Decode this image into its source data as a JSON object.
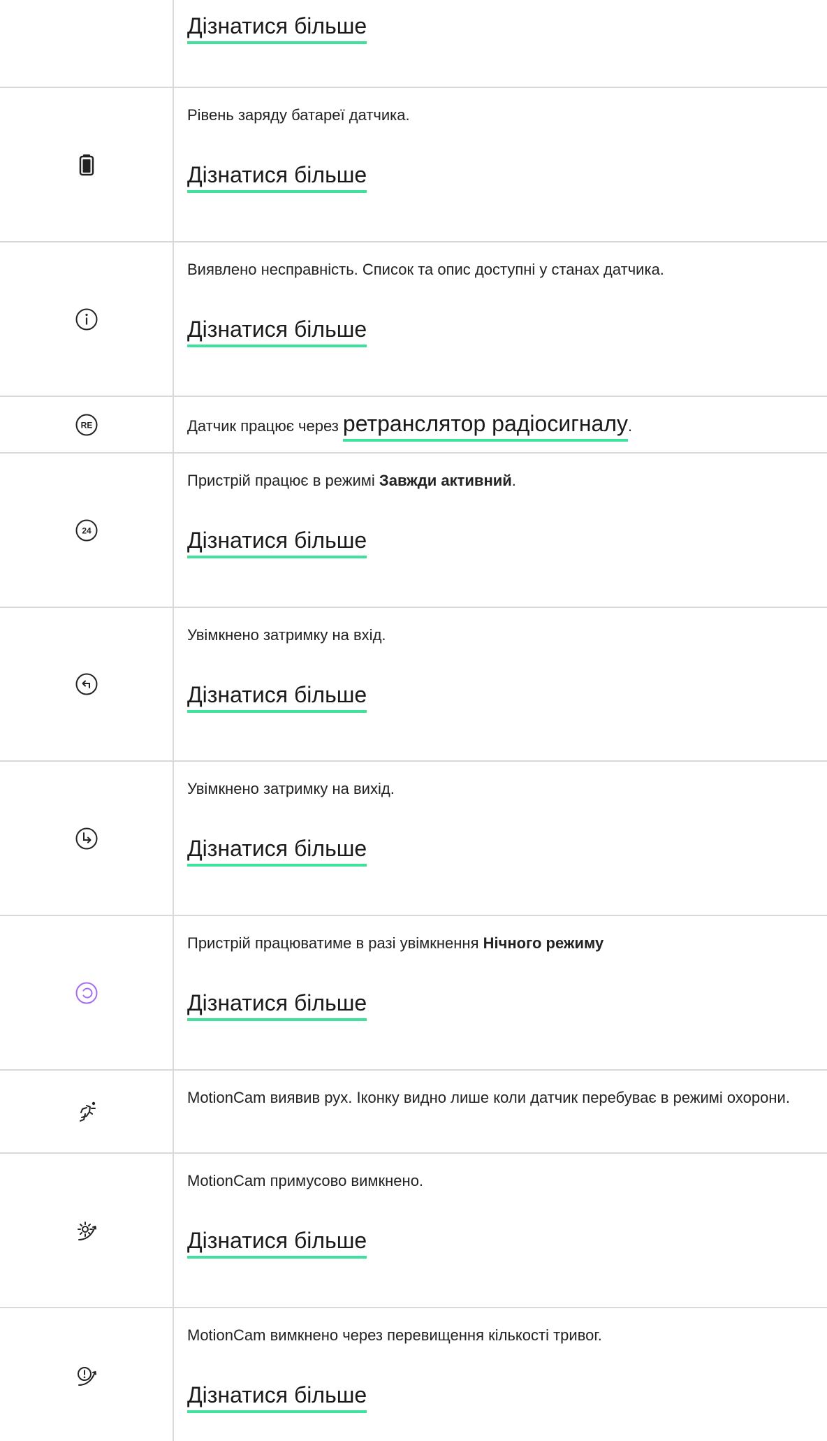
{
  "rows": [
    {
      "more": "Дізнатися більше"
    },
    {
      "icon": "battery-icon",
      "desc": "Рівень заряду батареї датчика.",
      "more": "Дізнатися більше"
    },
    {
      "icon": "info-icon",
      "desc": "Виявлено несправність. Список та опис доступні у станах датчика.",
      "more": "Дізнатися більше"
    },
    {
      "icon": "re-icon",
      "icon_text": "RE",
      "desc_before": "Датчик працює через ",
      "link": "ретранслятор радіосигналу",
      "desc_after": "."
    },
    {
      "icon": "always-active-24-icon",
      "icon_text": "24",
      "desc_before": "Пристрій працює в режимі ",
      "desc_bold": "Завжди активний",
      "desc_after": ".",
      "more": "Дізнатися більше"
    },
    {
      "icon": "entry-delay-icon",
      "desc": "Увімкнено затримку на вхід.",
      "more": "Дізнатися більше"
    },
    {
      "icon": "exit-delay-icon",
      "desc": "Увімкнено затримку на вихід.",
      "more": "Дізнатися більше"
    },
    {
      "icon": "night-mode-icon",
      "icon_color": "#a56cf0",
      "desc_before": "Пристрій працюватиме в разі увімкнення ",
      "desc_bold": "Нічного режиму",
      "more": "Дізнатися більше"
    },
    {
      "icon": "motion-detected-icon",
      "desc": "MotionCam виявив рух. Іконку видно лише коли датчик перебуває в режимі охорони."
    },
    {
      "icon": "forcibly-disabled-icon",
      "desc": "MotionCam примусово вимкнено.",
      "more": "Дізнатися більше"
    },
    {
      "icon": "alarm-limit-disabled-icon",
      "desc": "MotionCam вимкнено через перевищення кількості тривог.",
      "more": "Дізнатися більше"
    }
  ]
}
